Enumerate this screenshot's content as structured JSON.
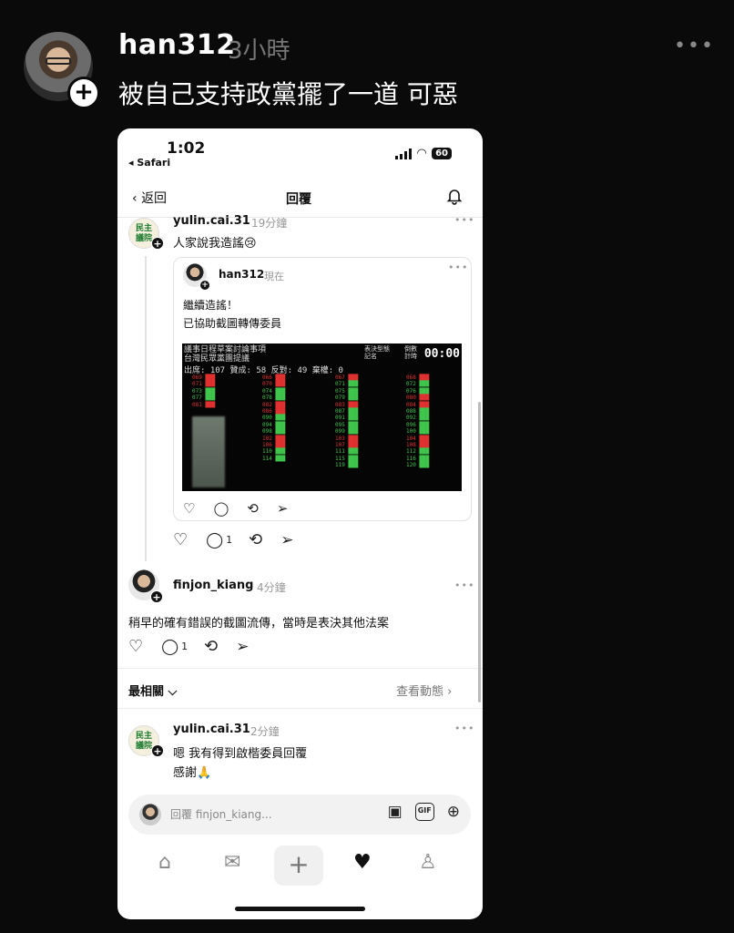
{
  "post": {
    "username": "han312",
    "time": "3小時",
    "more": "•••",
    "text": "被自己支持政黨擺了一道 可惡",
    "follow_plus": "+"
  },
  "phone": {
    "status": {
      "time": "1:02",
      "back_app": "◂ Safari",
      "battery": "60"
    },
    "nav": {
      "back": "返回",
      "title": "回覆"
    },
    "comment1": {
      "avatar_text": "民主\n議院",
      "username": "yulin.cai.31",
      "time": "19分鐘",
      "text": "人家說我造謠😢",
      "more": "•••"
    },
    "quote": {
      "username": "han312",
      "time": "現在",
      "more": "•••",
      "line1": "繼續造謠！",
      "line2": "已協助截圖轉傳委員",
      "board": {
        "header1": "議事日程草案討論事項",
        "header2": "台灣民眾黨團提議",
        "vote_type": "表決型態\n記名",
        "countdown": "倒數\n計時",
        "timer": "00:00",
        "counts": "出席: 107   贊成: 58   反對: 49   棄權: 0"
      }
    },
    "comment2": {
      "username": "finjon_kiang",
      "time": "4分鐘",
      "text": "稍早的確有錯誤的截圖流傳，當時是表決其他法案",
      "more": "•••",
      "reply_count": "1"
    },
    "comment1_reply_count": "1",
    "section": {
      "relevant": "最相關 ⌵",
      "activity": "查看動態 ›"
    },
    "comment3": {
      "avatar_text": "民主\n議院",
      "username": "yulin.cai.31",
      "time": "2分鐘",
      "line1": "嗯 我有得到啟楷委員回覆",
      "line2": "感謝🙏",
      "more": "•••"
    },
    "reply_bar": {
      "placeholder": "回覆 finjon_kiang..."
    }
  }
}
